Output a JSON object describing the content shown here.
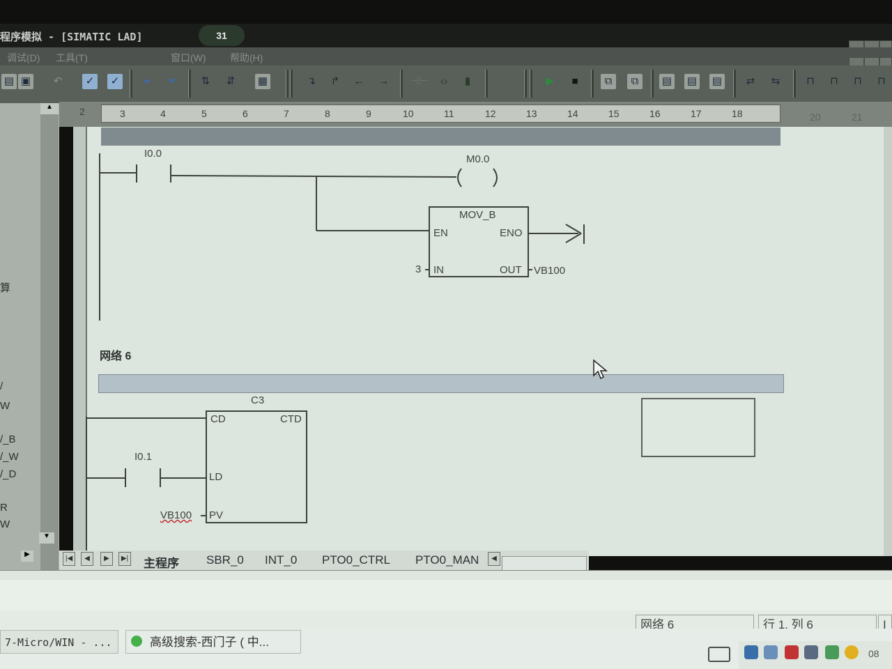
{
  "window": {
    "title": "程序模拟 - [SIMATIC LAD]",
    "badge": "31"
  },
  "menu": {
    "items": [
      "调试(D)",
      "工具(T)",
      "窗口(W)",
      "帮助(H)"
    ]
  },
  "ruler": {
    "numbers": [
      "3",
      "4",
      "5",
      "6",
      "7",
      "8",
      "9",
      "10",
      "11",
      "12",
      "13",
      "14",
      "15",
      "16",
      "17",
      "18"
    ],
    "extra": [
      "20",
      "21"
    ],
    "left_num": "2"
  },
  "left_panel": {
    "items": [
      "算",
      "/",
      "W",
      "/_B",
      "/_W",
      "/_D",
      "R",
      "W"
    ]
  },
  "ladder": {
    "rung5": {
      "contact": "I0.0",
      "coil": "M0.0",
      "box_title": "MOV_B",
      "box_en": "EN",
      "box_eno": "ENO",
      "box_in": "IN",
      "box_out": "OUT",
      "in_value": "3",
      "out_value": "VB100"
    },
    "network6": {
      "label": "网络 6",
      "counter_name": "C3",
      "counter_type": "CTD",
      "pin_cd": "CD",
      "pin_ld": "LD",
      "pin_pv": "PV",
      "contact": "I0.1",
      "pv_value": "VB100"
    }
  },
  "tabs": {
    "items": [
      "主程序",
      "SBR_0",
      "INT_0",
      "PTO0_CTRL",
      "PTO0_MAN"
    ],
    "active": "主程序"
  },
  "status": {
    "network": "网络 6",
    "position": "行 1, 列 6",
    "mode": "I"
  },
  "taskbar": {
    "items": [
      "7-Micro/WIN - ...",
      "高级搜索-西门子 ( 中..."
    ],
    "clock": "08"
  }
}
